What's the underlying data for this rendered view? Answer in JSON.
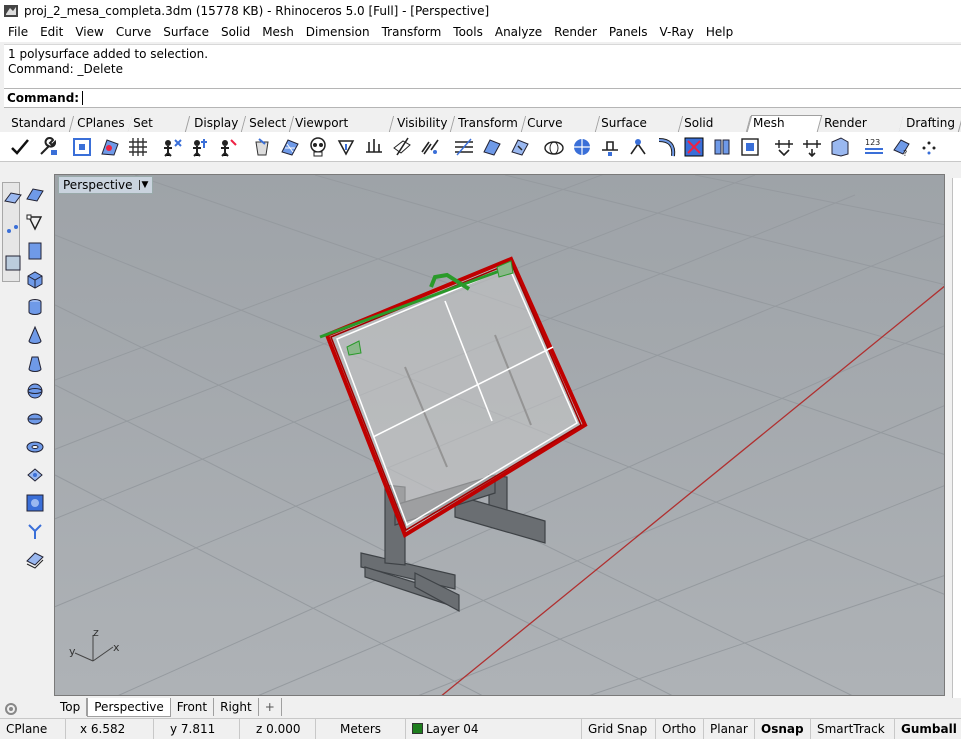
{
  "window": {
    "title": "proj_2_mesa_completa.3dm (15778 KB) - Rhinoceros 5.0 [Full] - [Perspective]"
  },
  "menu": [
    "File",
    "Edit",
    "View",
    "Curve",
    "Surface",
    "Solid",
    "Mesh",
    "Dimension",
    "Transform",
    "Tools",
    "Analyze",
    "Render",
    "Panels",
    "V-Ray",
    "Help"
  ],
  "history": {
    "line1": "1 polysurface added to selection.",
    "line2": "Command: _Delete"
  },
  "command": {
    "label": "Command:"
  },
  "toolbar_tabs": [
    {
      "label": "Standard",
      "active": false
    },
    {
      "label": "CPlanes",
      "active": false
    },
    {
      "label": "Set View",
      "active": false
    },
    {
      "label": "Display",
      "active": false
    },
    {
      "label": "Select",
      "active": false
    },
    {
      "label": "Viewport Layout",
      "active": false
    },
    {
      "label": "Visibility",
      "active": false
    },
    {
      "label": "Transform",
      "active": false
    },
    {
      "label": "Curve Tools",
      "active": false
    },
    {
      "label": "Surface Tools",
      "active": false
    },
    {
      "label": "Solid Tools",
      "active": false
    },
    {
      "label": "Mesh Tools",
      "active": true
    },
    {
      "label": "Render Tools",
      "active": false
    },
    {
      "label": "Drafting",
      "active": false
    }
  ],
  "viewport": {
    "label": "Perspective",
    "axes": {
      "x": "x",
      "y": "y",
      "z": "z"
    }
  },
  "viewport_tabs": [
    {
      "label": "Top",
      "active": false
    },
    {
      "label": "Perspective",
      "active": true
    },
    {
      "label": "Front",
      "active": false
    },
    {
      "label": "Right",
      "active": false
    }
  ],
  "viewport_tab_add": "+",
  "status": {
    "cplane": "CPlane",
    "x": "x 6.582",
    "y": "y 7.811",
    "z": "z 0.000",
    "units": "Meters",
    "layer": "Layer 04",
    "layer_color": "#1d7d1d",
    "grid_snap": "Grid Snap",
    "ortho": "Ortho",
    "planar": "Planar",
    "osnap": "Osnap",
    "smarttrack": "SmartTrack",
    "gumball": "Gumball"
  },
  "colors": {
    "selection_red": "#c00000",
    "viewport_bg": "#a8acb0",
    "axis_red": "#b03030"
  }
}
